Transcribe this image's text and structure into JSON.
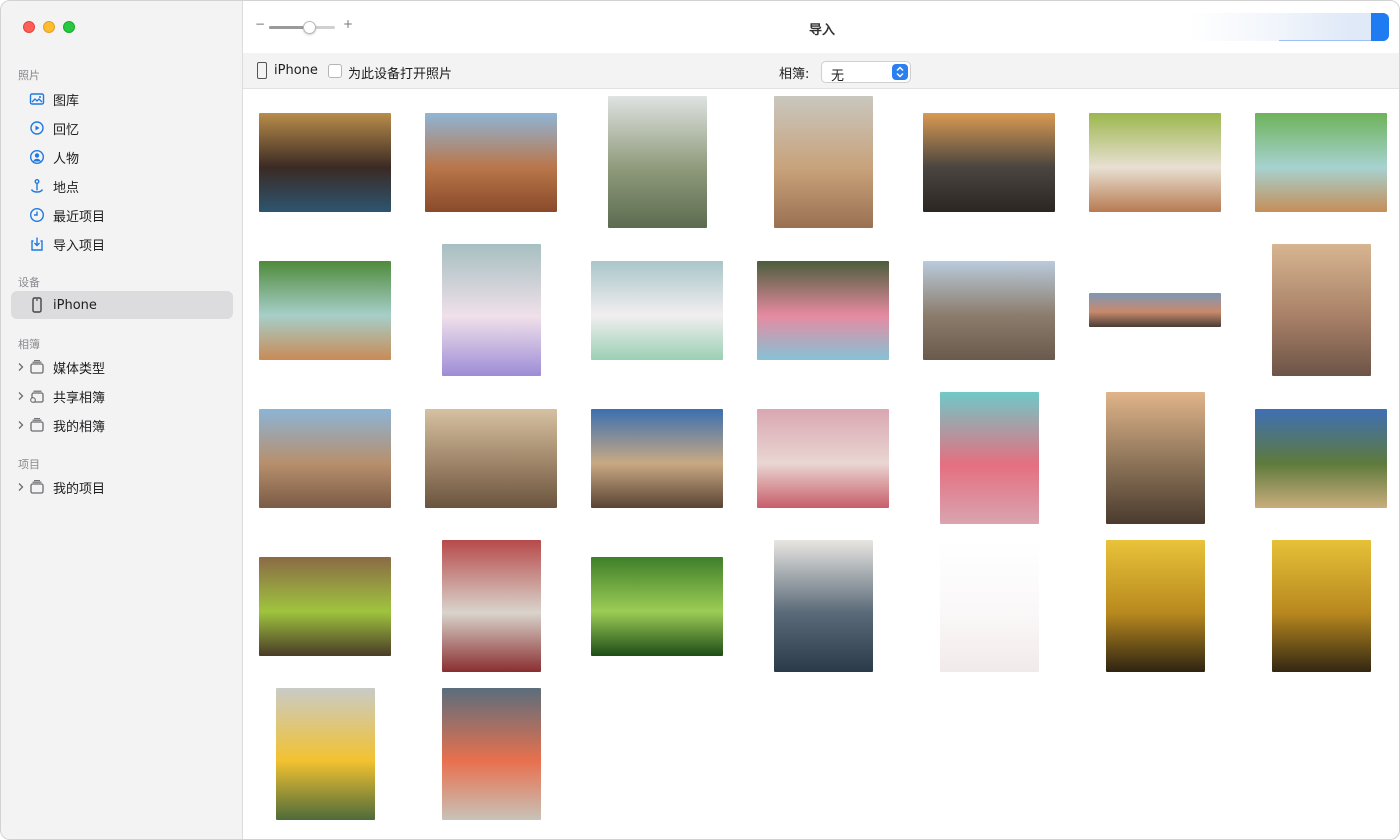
{
  "window": {
    "title": "导入"
  },
  "sidebar": {
    "sections": [
      {
        "title": "照片"
      },
      {
        "title": "设备"
      },
      {
        "title": "相簿"
      },
      {
        "title": "项目"
      }
    ],
    "library_items": [
      {
        "label": "图库",
        "icon": "photo-library-icon"
      },
      {
        "label": "回忆",
        "icon": "memories-icon"
      },
      {
        "label": "人物",
        "icon": "people-icon"
      },
      {
        "label": "地点",
        "icon": "places-icon"
      },
      {
        "label": "最近项目",
        "icon": "clock-icon"
      },
      {
        "label": "导入项目",
        "icon": "import-icon"
      }
    ],
    "device_items": [
      {
        "label": "iPhone",
        "icon": "iphone-icon"
      }
    ],
    "album_items": [
      {
        "label": "媒体类型",
        "icon": "folder-icon"
      },
      {
        "label": "共享相簿",
        "icon": "shared-folder-icon"
      },
      {
        "label": "我的相簿",
        "icon": "folder-icon"
      }
    ],
    "project_items": [
      {
        "label": "我的项目",
        "icon": "folder-icon"
      }
    ]
  },
  "toolbar": {
    "zoom_level": 0.6
  },
  "devicebar": {
    "device_name": "iPhone",
    "open_on_connect_label": "为此设备打开照片",
    "open_on_connect_checked": false,
    "album_label": "相簿:",
    "album_value": "无"
  },
  "photos": [
    {
      "name": "boston-terrier-on-rug",
      "colors": [
        "#b98d4a",
        "#3b2a24",
        "#2d5570"
      ]
    },
    {
      "name": "desert-road-canyon",
      "colors": [
        "#8fb5d6",
        "#b9764a",
        "#8a4a2a"
      ]
    },
    {
      "name": "eucalyptus-plant",
      "colors": [
        "#dfe3e2",
        "#8e9a7a",
        "#5c6b50"
      ]
    },
    {
      "name": "white-rock-formation",
      "colors": [
        "#c9c7bf",
        "#c8a27a",
        "#9a7052"
      ]
    },
    {
      "name": "sunset-over-ocean",
      "colors": [
        "#d99a52",
        "#4a4540",
        "#2a2622"
      ]
    },
    {
      "name": "pastry-on-green-table",
      "colors": [
        "#9cb74d",
        "#e8e0d2",
        "#b77a52"
      ]
    },
    {
      "name": "conchas-on-blue-plate",
      "colors": [
        "#6db35a",
        "#a7d2d0",
        "#c58e58"
      ]
    },
    {
      "name": "concha-and-pastry-plate",
      "colors": [
        "#4f8a3a",
        "#a6cfc9",
        "#c88b55"
      ]
    },
    {
      "name": "macarons-on-plate-top",
      "colors": [
        "#a6bfc0",
        "#f0e0ea",
        "#9d8cd6"
      ]
    },
    {
      "name": "macarons-on-white-plate",
      "colors": [
        "#a9c6c9",
        "#f2eef0",
        "#9ad0b4"
      ]
    },
    {
      "name": "macaron-tower",
      "colors": [
        "#4b5d3c",
        "#e68aa0",
        "#86c2d6"
      ]
    },
    {
      "name": "panoramic-mountains",
      "colors": [
        "#b9cbdc",
        "#8c7c6c",
        "#6a5a4d"
      ]
    },
    {
      "name": "mountain-dusk",
      "colors": [
        "#7d97b6",
        "#c98a6c",
        "#4a3d36"
      ]
    },
    {
      "name": "boulders-at-sunset",
      "colors": [
        "#d7b591",
        "#a88067",
        "#6d5447"
      ]
    },
    {
      "name": "rocky-desert-valley",
      "colors": [
        "#8cb4d6",
        "#b78f6c",
        "#7a5b46"
      ]
    },
    {
      "name": "hazy-desert-mountains",
      "colors": [
        "#d6c1a2",
        "#9e8468",
        "#6a543f"
      ]
    },
    {
      "name": "rock-arch-blue-sky",
      "colors": [
        "#3b6fb0",
        "#c9a984",
        "#5a4334"
      ]
    },
    {
      "name": "pink-cake-table-top",
      "colors": [
        "#d9a7b2",
        "#e9d6d2",
        "#c85d6a"
      ]
    },
    {
      "name": "pink-cake-teal-wall",
      "colors": [
        "#6fc9c9",
        "#e56f80",
        "#d9a4b0"
      ]
    },
    {
      "name": "dry-grass-sunset",
      "colors": [
        "#e0b48a",
        "#8a7257",
        "#4a3b2e"
      ]
    },
    {
      "name": "grass-seed-blue-sky",
      "colors": [
        "#3f6fb5",
        "#5e7a3c",
        "#c9ad7c"
      ]
    },
    {
      "name": "green-plant-stems",
      "colors": [
        "#8a6a45",
        "#9fc43e",
        "#4a3b27"
      ]
    },
    {
      "name": "allium-flower-red",
      "colors": [
        "#b74a4a",
        "#d9d4cc",
        "#8a2e30"
      ]
    },
    {
      "name": "green-leaf-closeup",
      "colors": [
        "#3e7f2a",
        "#9ccc55",
        "#1e4d18"
      ]
    },
    {
      "name": "peacock-feather",
      "colors": [
        "#e8e6e2",
        "#5a6a78",
        "#2a3a48"
      ]
    },
    {
      "name": "blank-white-photo",
      "colors": [
        "#ffffff",
        "#faf8f8",
        "#f2eaea"
      ]
    },
    {
      "name": "yellow-gerbera-closeup-1",
      "colors": [
        "#e9c33a",
        "#b8891e",
        "#2e2412"
      ]
    },
    {
      "name": "yellow-gerbera-closeup-2",
      "colors": [
        "#e6c137",
        "#b8881f",
        "#322712"
      ]
    },
    {
      "name": "yellow-flower-on-stem",
      "colors": [
        "#c9cbc7",
        "#f2c230",
        "#4e6b3a"
      ]
    },
    {
      "name": "grapefruit-slices",
      "colors": [
        "#5a6e7c",
        "#e8704e",
        "#c8c2b8"
      ]
    }
  ]
}
